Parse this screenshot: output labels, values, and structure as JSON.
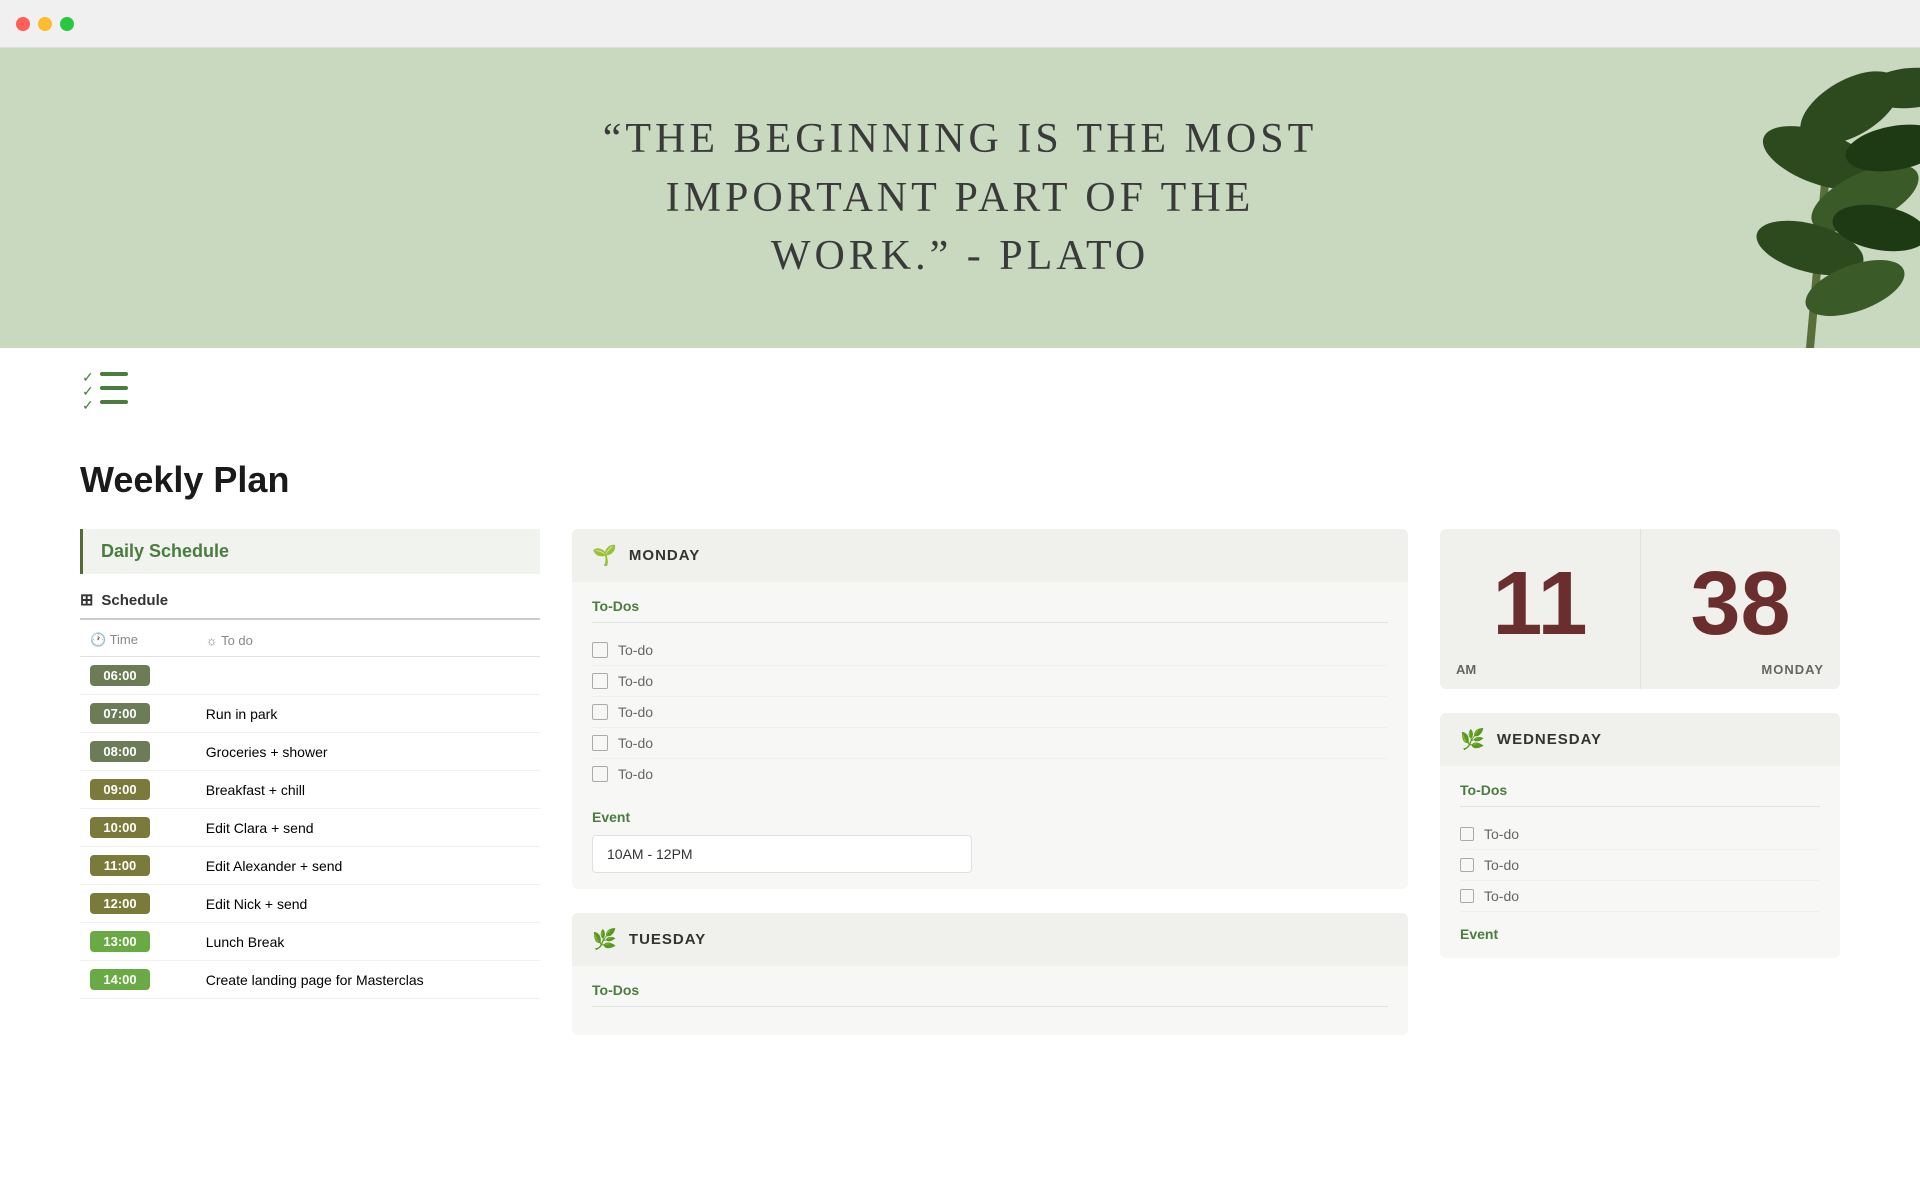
{
  "browser": {
    "dots": [
      "red",
      "yellow",
      "green"
    ]
  },
  "hero": {
    "quote": "“The Beginning is the Most\nImportant Part of the\nWork.” - Plato"
  },
  "page": {
    "title": "Weekly Plan"
  },
  "left_panel": {
    "header": "Daily Schedule",
    "schedule_icon": "⊞",
    "schedule_label": "Schedule",
    "col_time": "Time",
    "col_todo": "To do",
    "rows": [
      {
        "time": "06:00",
        "task": "",
        "color": "time-600"
      },
      {
        "time": "07:00",
        "task": "Run in park",
        "color": "time-700"
      },
      {
        "time": "08:00",
        "task": "Groceries + shower",
        "color": "time-800"
      },
      {
        "time": "09:00",
        "task": "Breakfast + chill",
        "color": "time-900"
      },
      {
        "time": "10:00",
        "task": "Edit Clara + send",
        "color": "time-1000"
      },
      {
        "time": "11:00",
        "task": "Edit Alexander + send",
        "color": "time-1100"
      },
      {
        "time": "12:00",
        "task": "Edit Nick + send",
        "color": "time-1200"
      },
      {
        "time": "13:00",
        "task": "Lunch Break",
        "color": "time-1300"
      },
      {
        "time": "14:00",
        "task": "Create landing page for Masterclas",
        "color": "time-1400"
      }
    ]
  },
  "monday": {
    "icon": "🌱",
    "name": "MONDAY",
    "todos_label": "To-Dos",
    "todos": [
      "To-do",
      "To-do",
      "To-do",
      "To-do",
      "To-do"
    ],
    "event_label": "Event",
    "event_value": "10AM - 12PM"
  },
  "tuesday": {
    "icon": "🌿",
    "name": "TUESDAY",
    "todos_label": "To-Dos"
  },
  "clock": {
    "hours": "11",
    "minutes": "38",
    "am_label": "AM",
    "day_label": "MONDAY"
  },
  "wednesday": {
    "icon": "🌿",
    "name": "WEDNESDAY",
    "todos_label": "To-Dos",
    "todos": [
      "To-do",
      "To-do",
      "To-do"
    ],
    "event_label": "Event"
  }
}
